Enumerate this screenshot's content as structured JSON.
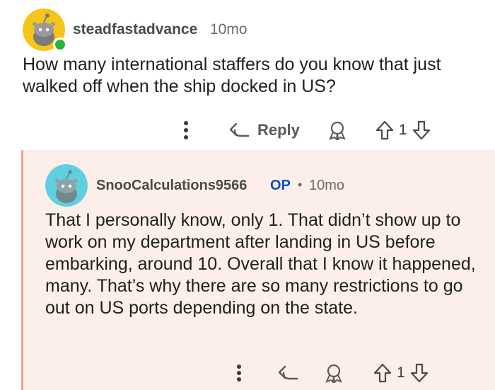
{
  "parent_comment": {
    "username": "steadfastadvance",
    "age": "10mo",
    "text": "How many international staffers do you know that just walked off when the ship docked in US?",
    "actions": {
      "more_icon": "more-vertical-icon",
      "reply_label": "Reply",
      "award_icon": "award-icon",
      "vote_count": "1"
    }
  },
  "reply_comment": {
    "username": "SnooCalculations9566",
    "op_badge": "OP",
    "separator": "•",
    "age": "10mo",
    "text": "That I personally know, only 1. That didn’t show up to work on my department after landing in US before embarking, around 10. Overall that I know it happened, many. That’s why there are so many restrictions to go out on US ports depending on the state.",
    "actions": {
      "more_icon": "more-vertical-icon",
      "award_icon": "award-icon",
      "vote_count": "1"
    }
  },
  "colors": {
    "avatar_yellow": "#f5c518",
    "avatar_teal": "#5fd0e0",
    "online_green": "#2bb43a",
    "reply_background": "#fcefea",
    "thread_line": "#f1a48f",
    "op_blue": "#0a4ec2"
  }
}
